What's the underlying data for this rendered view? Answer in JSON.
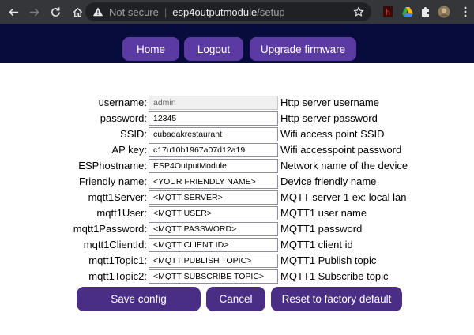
{
  "browser": {
    "security_text": "Not secure",
    "separator": "|",
    "url_host": "esp4outputmodule",
    "url_path": "/setup",
    "icons": {
      "back": "back-arrow-icon",
      "forward": "forward-arrow-icon",
      "reload": "reload-icon",
      "home": "home-icon",
      "warning": "warning-triangle-icon",
      "bookmark": "star-icon",
      "extensions": [
        "red-extension-icon",
        "google-drive-icon",
        "puzzle-extensions-icon",
        "profile-avatar-icon"
      ],
      "menu": "kebab-menu-icon"
    }
  },
  "header": {
    "home_label": "Home",
    "logout_label": "Logout",
    "upgrade_label": "Upgrade firmware"
  },
  "form": {
    "fields": [
      {
        "label": "username:",
        "value": "admin",
        "description": "Http server username",
        "readonly": true
      },
      {
        "label": "password:",
        "value": "12345",
        "description": "Http server password"
      },
      {
        "label": "SSID:",
        "value": "cubadakrestaurant",
        "description": "Wifi access point SSID"
      },
      {
        "label": "AP key:",
        "value": "c17u10b1967a07d12a19",
        "description": "Wifi accesspoint password"
      },
      {
        "label": "ESPhostname:",
        "value": "ESP4OutputModule",
        "description": "Network name of the device"
      },
      {
        "label": "Friendly name:",
        "value": "<YOUR FRIENDLY NAME>",
        "description": "Device friendly name"
      },
      {
        "label": "mqtt1Server:",
        "value": "<MQTT SERVER>",
        "description": "MQTT server 1 ex: local lan"
      },
      {
        "label": "mqtt1User:",
        "value": "<MQTT USER>",
        "description": "MQTT1 user name"
      },
      {
        "label": "mqtt1Password:",
        "value": "<MQTT PASSWORD>",
        "description": "MQTT1 password"
      },
      {
        "label": "mqtt1ClientId:",
        "value": "<MQTT CLIENT ID>",
        "description": "MQTT1 client id"
      },
      {
        "label": "mqtt1Topic1:",
        "value": "<MQTT PUBLISH TOPIC>",
        "description": "MQTT1 Publish topic"
      },
      {
        "label": "mqtt1Topic2:",
        "value": "<MQTT SUBSCRIBE TOPIC>",
        "description": "MQTT1 Subscribe topic"
      }
    ]
  },
  "actions": {
    "save_label": "Save config",
    "cancel_label": "Cancel",
    "reset_label": "Reset to factory default"
  },
  "colors": {
    "header_bg": "#080c3c",
    "menu_button": "#5b3aa3",
    "action_button": "#4a2d84"
  }
}
